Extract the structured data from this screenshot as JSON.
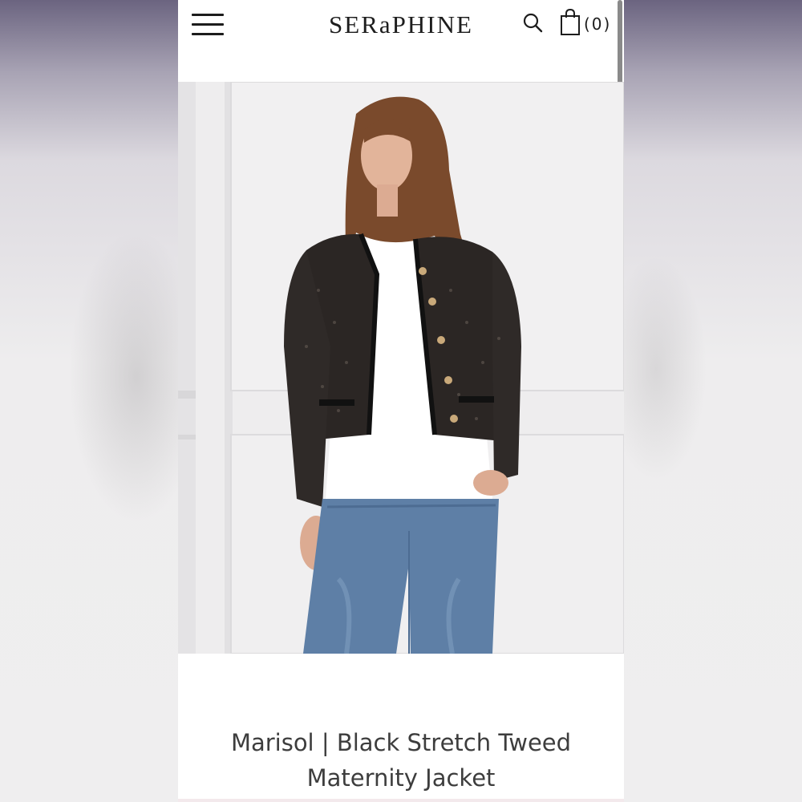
{
  "header": {
    "brand": "SERaPHINE",
    "menu_icon": "hamburger-menu-icon",
    "search_icon": "search-icon",
    "bag_icon": "shopping-bag-icon",
    "cart_count": "(0)"
  },
  "gallery": {
    "image": "model-wearing-black-tweed-jacket-white-tee-jeans",
    "slides_total": 5,
    "active_slide": 1
  },
  "product": {
    "title_line1": "Marisol | Black Stretch Tweed",
    "title_line2": "Maternity Jacket"
  },
  "colors": {
    "text": "#3d3d3d",
    "brand": "#1d1d1d"
  }
}
